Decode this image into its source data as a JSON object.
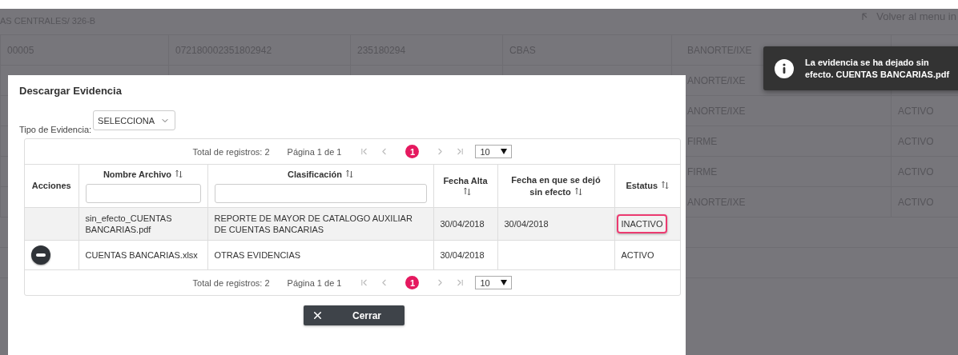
{
  "breadcrumb": "AS CENTRALES/ 326-B",
  "back_link": "Volver al menu in",
  "background_table": {
    "rows": [
      {
        "column_1": "00005",
        "column_2": "072180002351802942",
        "column_3": "235180294",
        "column_4": "CBAS",
        "column_5": "BANORTE/IXE"
      },
      {
        "column_5": "ANORTE/IXE"
      },
      {
        "column_5": "ANORTE/IXE",
        "column_6": "ACTIVO"
      },
      {
        "column_5": "FIRME",
        "column_6": "ACTIVO"
      },
      {
        "column_5": "FIRME",
        "column_6": "ACTIVO"
      },
      {
        "column_5": "ANORTE/IXE",
        "column_6": "ACTIVO"
      }
    ]
  },
  "toast": {
    "message": "La evidencia se ha dejado sin efecto. CUENTAS BANCARIAS.pdf"
  },
  "dialog": {
    "title": "Descargar Evidencia",
    "evidence_type": {
      "label": "Tipo de Evidencia:",
      "value": "SELECCIONA"
    },
    "pager_top": {
      "total": "Total de registros: 2",
      "page": "Página 1 de 1",
      "pages": [
        {
          "label": "1",
          "selected": true
        }
      ],
      "page_size": "10"
    },
    "columns": [
      {
        "label": "Acciones",
        "sortable": false,
        "filter": false
      },
      {
        "label": "Nombre Archivo",
        "sortable": true,
        "filter": true
      },
      {
        "label": "Clasificación",
        "sortable": true,
        "filter": true
      },
      {
        "label": "Fecha Alta",
        "sortable": true,
        "filter": false
      },
      {
        "label": "Fecha en que se dejó sin efecto",
        "sortable": true,
        "filter": false
      },
      {
        "label": "Estatus",
        "sortable": true,
        "filter": false
      }
    ],
    "rows": [
      {
        "has_action": false,
        "file": "sin_efecto_CUENTAS BANCARIAS.pdf",
        "classification": "REPORTE DE MAYOR DE CATALOGO AUXILIAR DE CUENTAS BANCARIAS",
        "date_created": "30/04/2018",
        "date_void": "30/04/2018",
        "status": "INACTIVO",
        "highlighted": true,
        "selected": true
      },
      {
        "has_action": true,
        "file": "CUENTAS BANCARIAS.xlsx",
        "classification": "OTRAS EVIDENCIAS",
        "date_created": "30/04/2018",
        "status": "ACTIVO",
        "highlighted": false,
        "selected": false
      }
    ],
    "pager_bottom": {
      "total": "Total de registros: 2",
      "page": "Página 1 de 1",
      "pages": [
        {
          "label": "1",
          "selected": true
        }
      ],
      "page_size": "10"
    },
    "close_button": "Cerrar"
  }
}
